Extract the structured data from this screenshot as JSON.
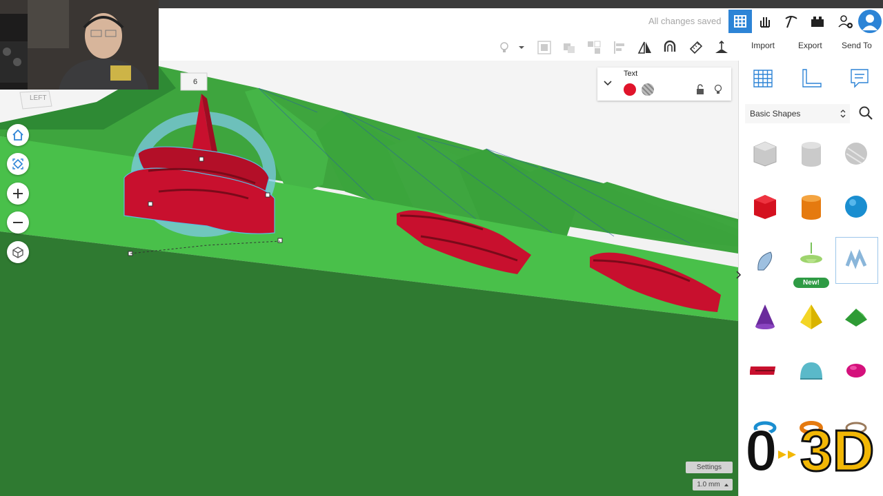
{
  "topbar": {
    "status": "All changes saved"
  },
  "toolbar": {
    "import_label": "Import",
    "export_label": "Export",
    "send_to_label": "Send To"
  },
  "viewcube": {
    "label": "LEFT"
  },
  "inspector": {
    "title": "Text",
    "solid_color": "#e0142b"
  },
  "dimension_label": "6",
  "sidebar": {
    "category": "Basic Shapes",
    "new_badge": "New!"
  },
  "workplane": {
    "settings_label": "Settings",
    "snap_grid": "1.0 mm"
  },
  "logo": {
    "text_left": "0",
    "text_right": "3D"
  },
  "colors": {
    "accent": "#2d84d6",
    "workplane_light": "#4bc14b",
    "workplane_dark": "#2f7a31",
    "shape_red": "#c8102e"
  }
}
